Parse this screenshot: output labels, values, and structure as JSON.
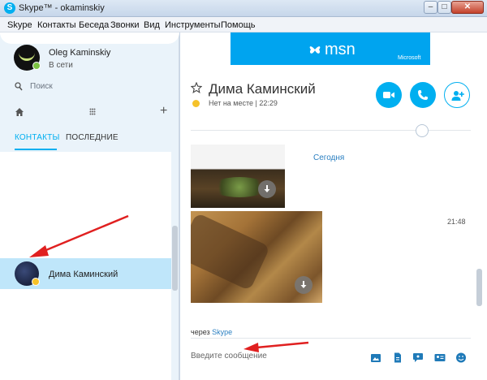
{
  "window": {
    "title": "Skype™ - okaminskiy",
    "logo": "S"
  },
  "menu": [
    "Skype",
    "Контакты",
    "Беседа",
    "Звонки",
    "Вид",
    "Инструменты",
    "Помощь"
  ],
  "profile": {
    "name": "Oleg Kaminskiy",
    "status": "В сети",
    "status_color": "#7bc143"
  },
  "search": {
    "placeholder": "Поиск"
  },
  "tabs": {
    "contacts": "КОНТАКТЫ",
    "recent": "ПОСЛЕДНИЕ"
  },
  "contacts": [
    {
      "name": "Дима Каминский",
      "presence": "away"
    }
  ],
  "ad": {
    "brand": "msn",
    "vendor": "Microsoft",
    "color": "#00a4ef"
  },
  "chat": {
    "name": "Дима Каминский",
    "status": "Нет на месте | 22:29",
    "date_label": "Сегодня",
    "time_label": "21:48",
    "via_prefix": "через",
    "via_app": "Skype",
    "input_placeholder": "Введите сообщение"
  },
  "colors": {
    "accent": "#00aff0",
    "away": "#f5c22a",
    "selected_row": "#bfe6fa",
    "annotation_arrow": "#e02020"
  },
  "icons": [
    "skype-logo-icon",
    "search-icon",
    "home-icon",
    "dialpad-icon",
    "plus-icon",
    "star-icon",
    "video-call-icon",
    "phone-icon",
    "add-contact-icon",
    "download-icon",
    "image-share-icon",
    "file-icon",
    "video-message-icon",
    "contact-card-icon",
    "emoticon-icon"
  ]
}
